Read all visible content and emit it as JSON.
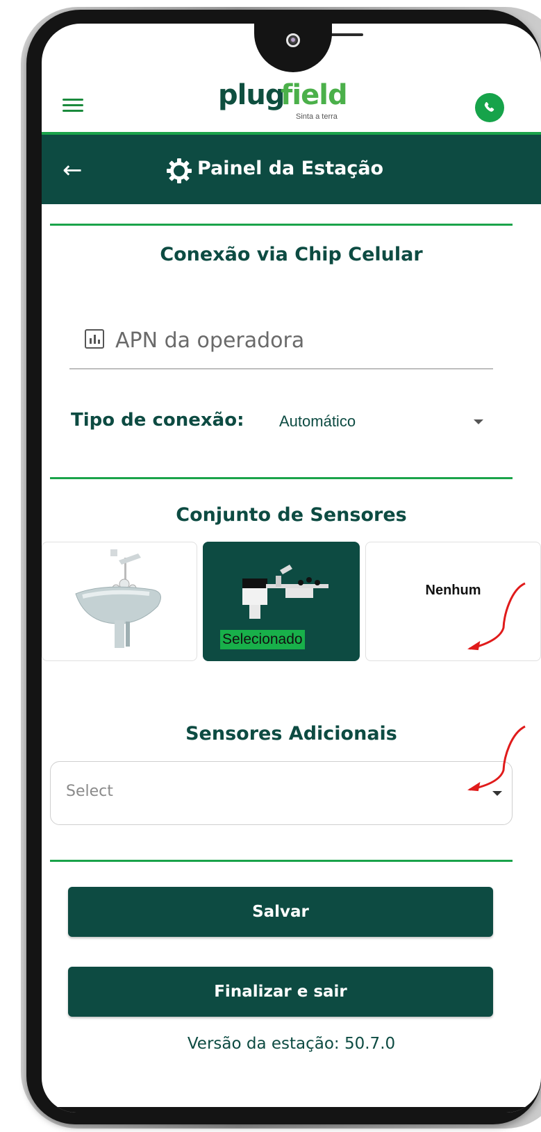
{
  "app": {
    "logo_plug": "plug",
    "logo_field": "field",
    "logo_tagline": "Sinta a terra"
  },
  "header": {
    "title": "Painel da Estação"
  },
  "connection": {
    "section_title": "Conexão via Chip Celular",
    "apn_placeholder": "APN da operadora",
    "type_label": "Tipo de conexão:",
    "type_value": "Automático"
  },
  "sensor_set": {
    "section_title": "Conjunto de Sensores",
    "options": [
      {
        "label": "",
        "selected": false
      },
      {
        "label": "",
        "selected": true,
        "badge": "Selecionado"
      },
      {
        "label": "Nenhum",
        "selected": false
      }
    ]
  },
  "additional_sensors": {
    "section_title": "Sensores Adicionais",
    "placeholder": "Select"
  },
  "actions": {
    "save_label": "Salvar",
    "finish_label": "Finalizar e sair"
  },
  "footer": {
    "version_text": "Versão da estação: 50.7.0"
  },
  "colors": {
    "primary": "#0d4b42",
    "accent": "#1aa34a",
    "badge": "#18b04a",
    "annotation_arrow": "#e01b1b"
  }
}
